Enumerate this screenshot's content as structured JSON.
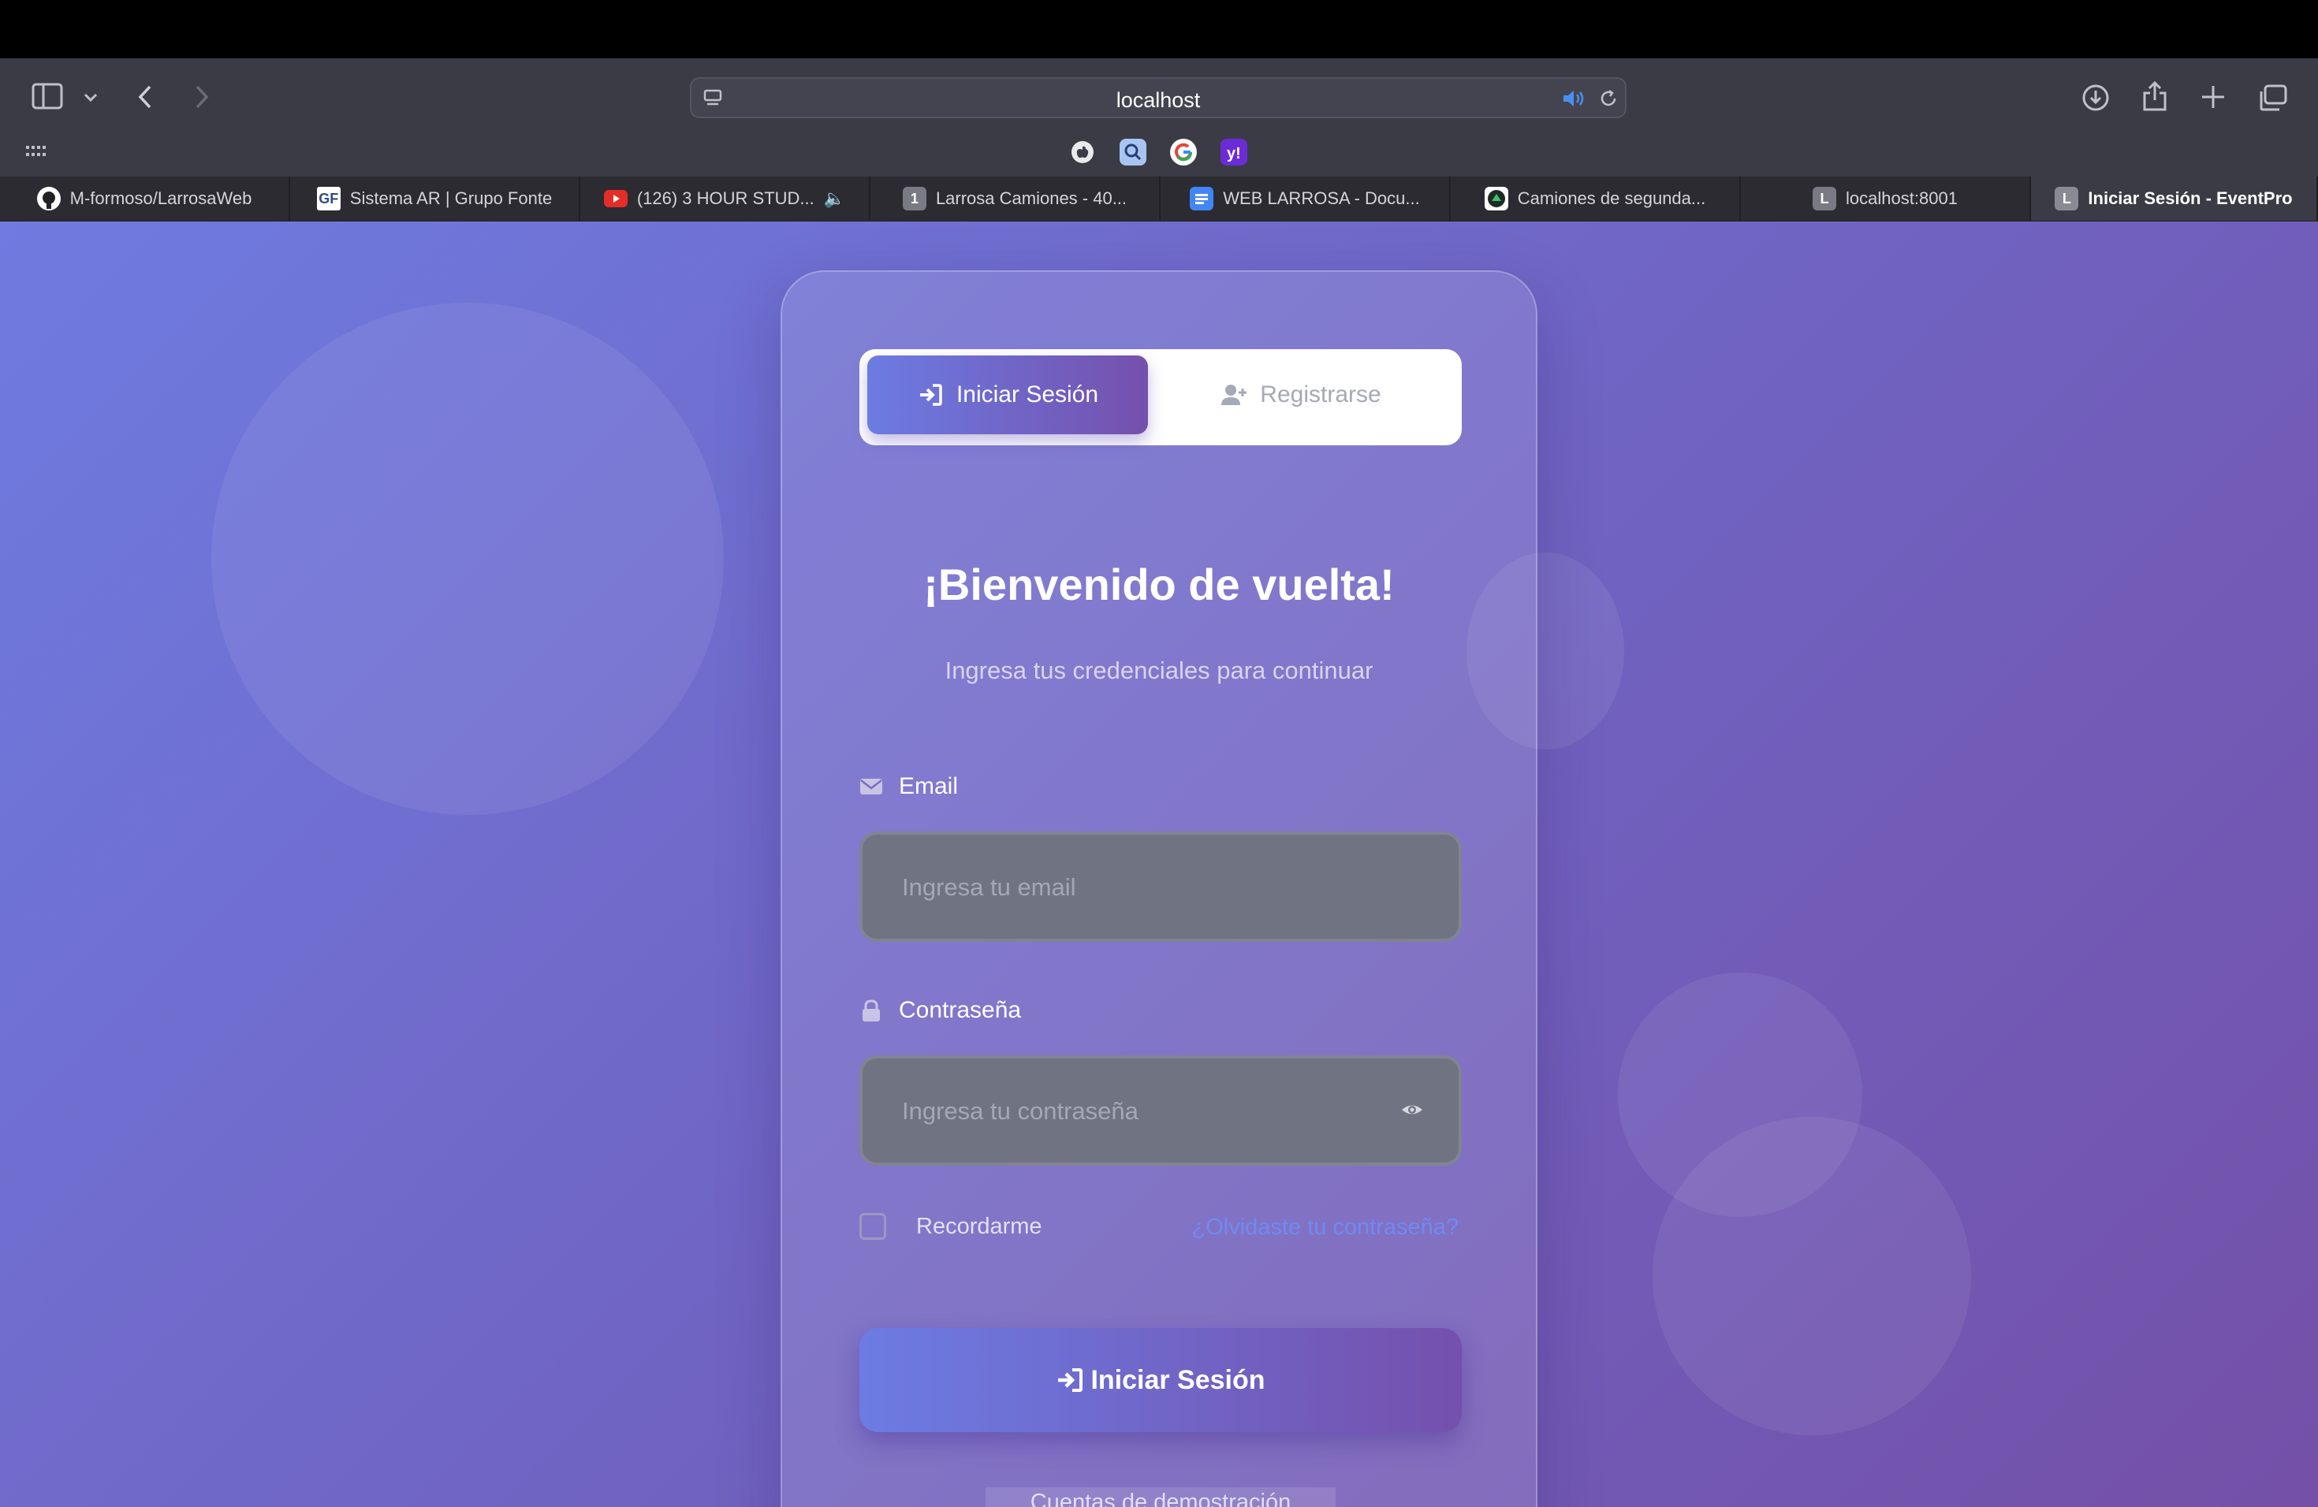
{
  "browser": {
    "url": "localhost",
    "favorites": [
      "apple-icon",
      "search-icon",
      "google-icon",
      "yahoo-icon"
    ],
    "tabs": [
      {
        "label": "M-formoso/LarrosaWeb",
        "icon": "github-icon"
      },
      {
        "label": "Sistema AR | Grupo Fonte",
        "icon": "gf-icon"
      },
      {
        "label": "(126) 3 HOUR STUD...",
        "icon": "youtube-icon"
      },
      {
        "label": "Larrosa Camiones - 40...",
        "icon": "1"
      },
      {
        "label": "WEB LARROSA - Docu...",
        "icon": "docs-icon"
      },
      {
        "label": "Camiones de segunda...",
        "icon": "site-icon"
      },
      {
        "label": "localhost:8001",
        "icon": "L"
      },
      {
        "label": "Iniciar Sesión - EventPro",
        "icon": "L"
      }
    ]
  },
  "auth": {
    "login_tab": "Iniciar Sesión",
    "register_tab": "Registrarse",
    "title": "¡Bienvenido de vuelta!",
    "subtitle": "Ingresa tus credenciales para continuar",
    "email_label": "Email",
    "email_placeholder": "Ingresa tu email",
    "password_label": "Contraseña",
    "password_placeholder": "Ingresa tu contraseña",
    "remember_label": "Recordarme",
    "forgot_link": "¿Olvidaste tu contraseña?",
    "submit_label": "Iniciar Sesión",
    "demo_label": "Cuentas de demostración"
  },
  "colors": {
    "accent_start": "#6c7ce3",
    "accent_end": "#7550ad",
    "link": "#6e8bf2"
  }
}
